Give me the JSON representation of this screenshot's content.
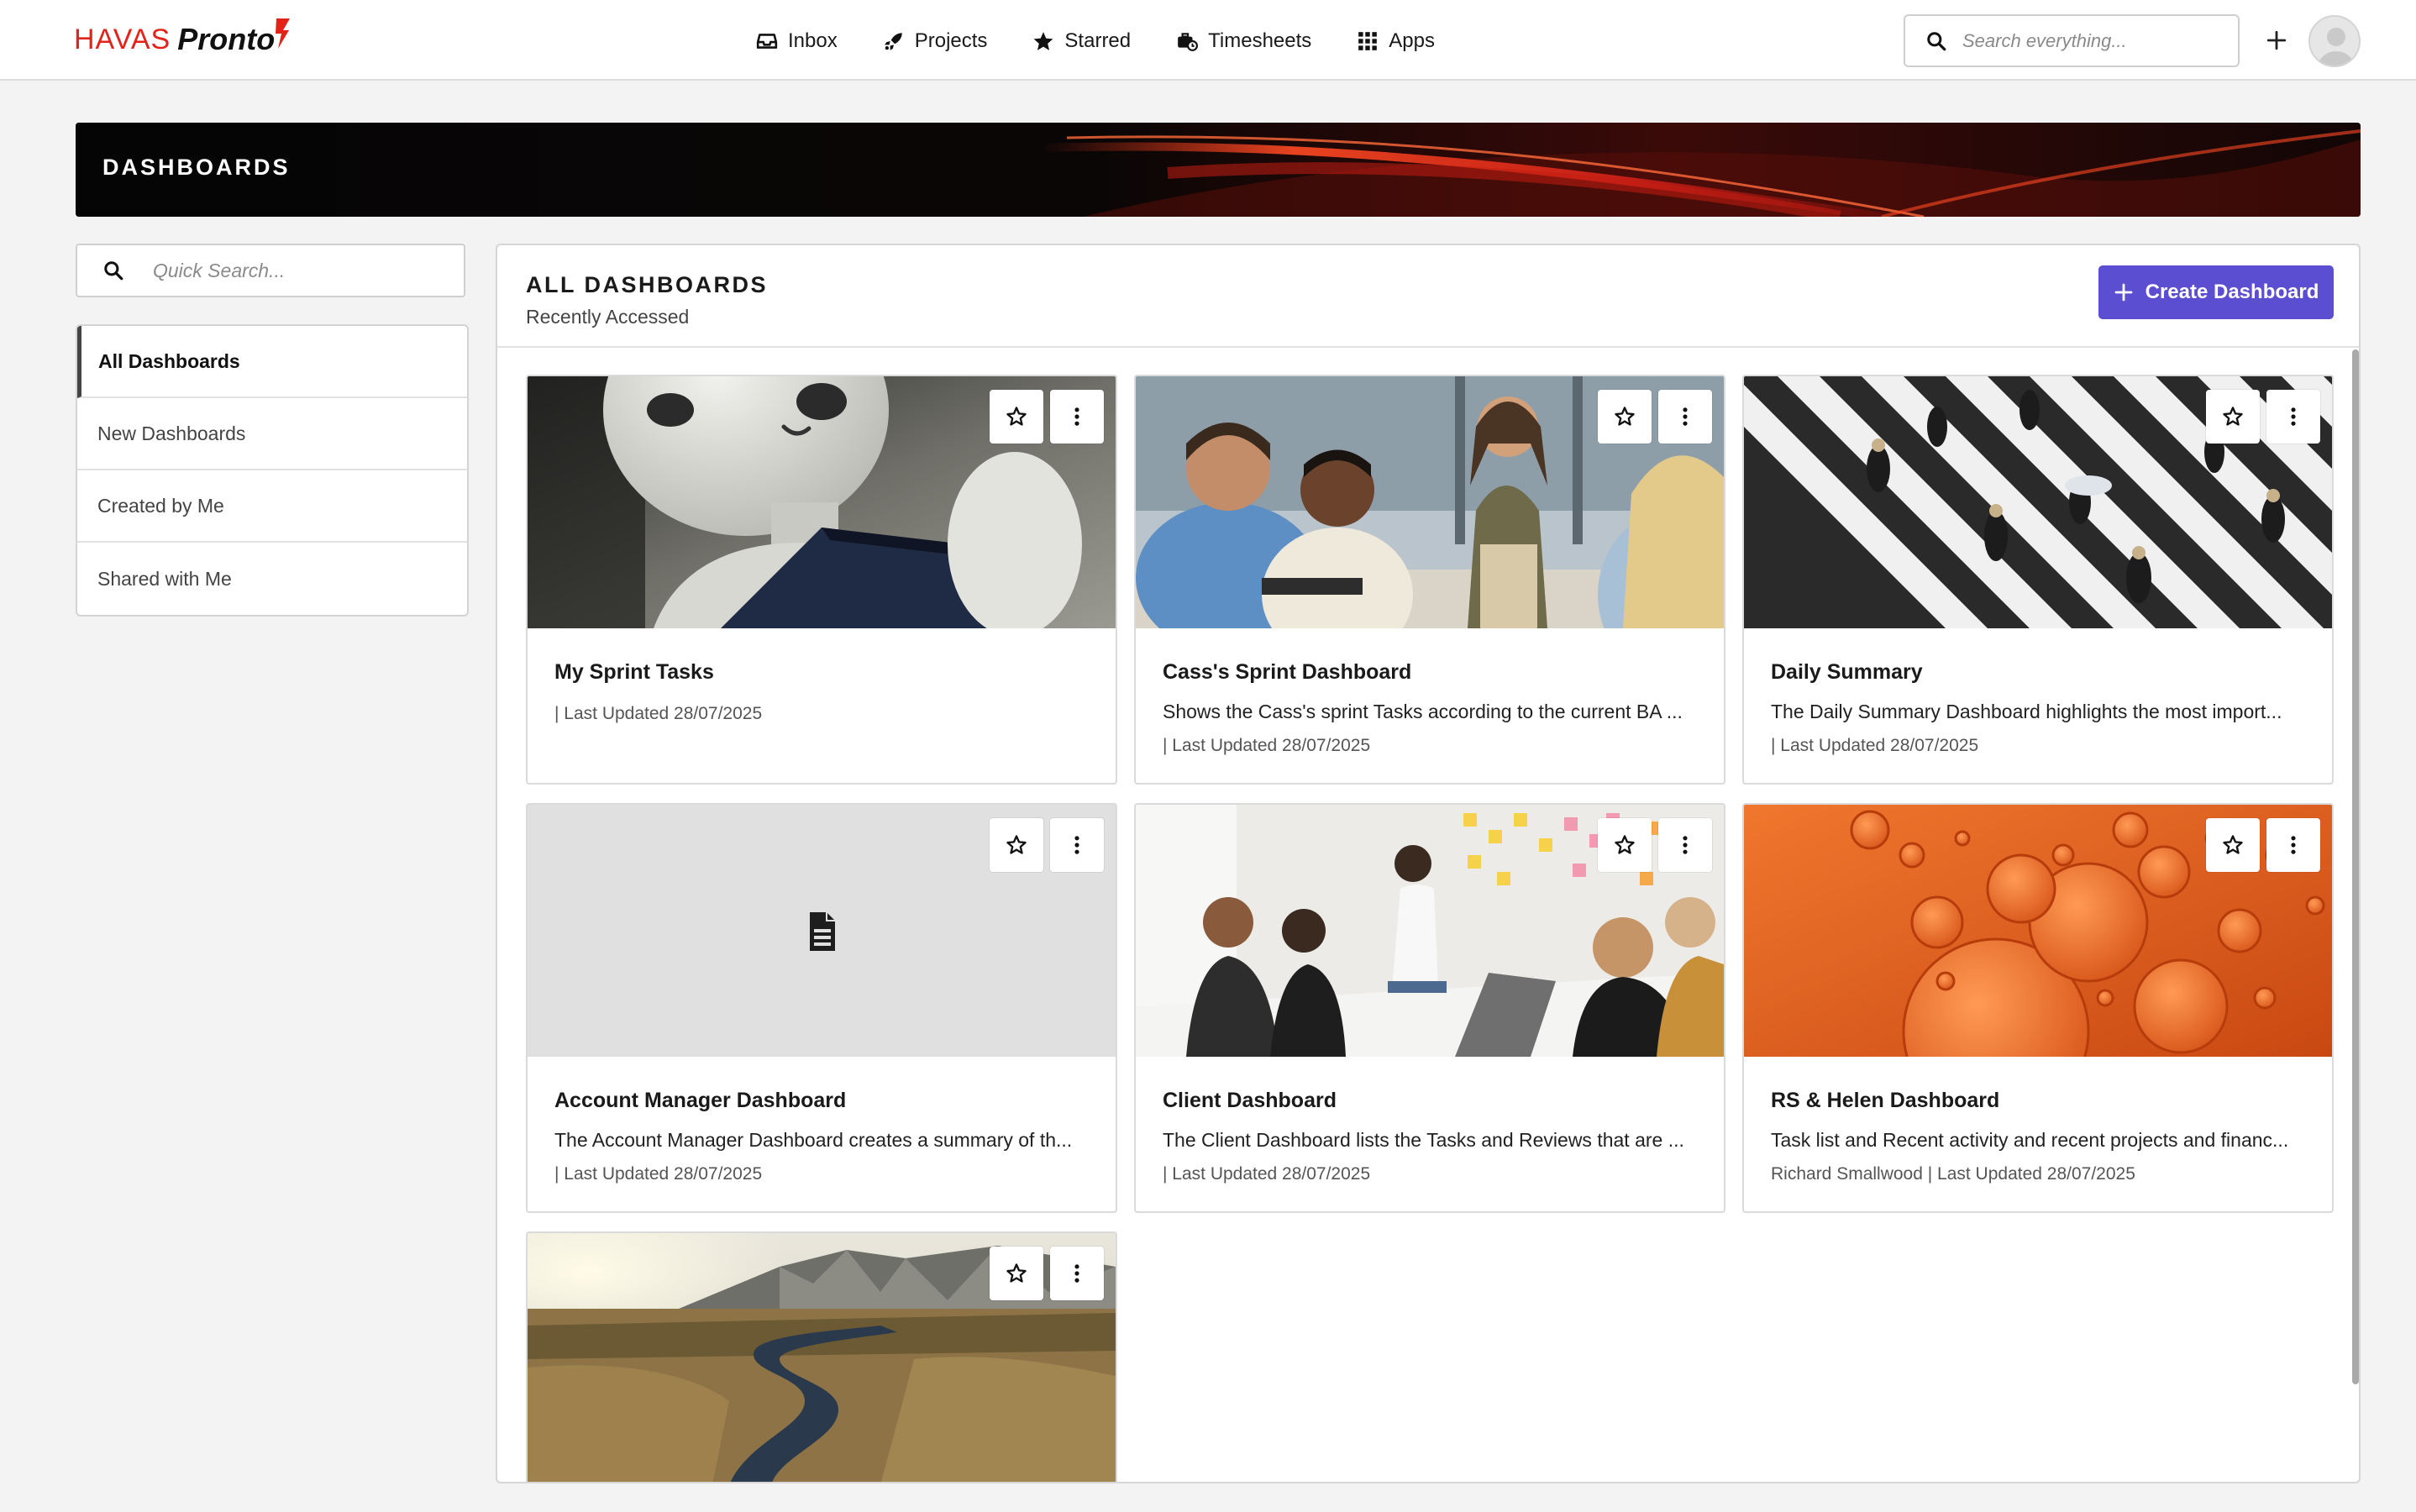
{
  "brand": {
    "name_red": "HAVAS",
    "name_black": "Pronto"
  },
  "nav": {
    "items": [
      {
        "label": "Inbox",
        "icon": "inbox-icon"
      },
      {
        "label": "Projects",
        "icon": "rocket-icon"
      },
      {
        "label": "Starred",
        "icon": "star-icon"
      },
      {
        "label": "Timesheets",
        "icon": "timesheet-icon"
      },
      {
        "label": "Apps",
        "icon": "apps-grid-icon"
      }
    ],
    "search_placeholder": "Search everything..."
  },
  "banner": {
    "title": "DASHBOARDS"
  },
  "sidebar": {
    "search_placeholder": "Quick Search...",
    "items": [
      {
        "label": "All Dashboards",
        "active": true
      },
      {
        "label": "New Dashboards",
        "active": false
      },
      {
        "label": "Created by Me",
        "active": false
      },
      {
        "label": "Shared with Me",
        "active": false
      }
    ]
  },
  "main": {
    "title": "ALL DASHBOARDS",
    "subtitle": "Recently Accessed",
    "create_label": "Create Dashboard",
    "cards": [
      {
        "title": "My Sprint Tasks",
        "description": "",
        "meta": "| Last Updated 28/07/2025",
        "image": "robot-photo"
      },
      {
        "title": "Cass's Sprint Dashboard",
        "description": "Shows the Cass's sprint Tasks according to the current BA ...",
        "meta": "| Last Updated 28/07/2025",
        "image": "meeting-photo"
      },
      {
        "title": "Daily Summary",
        "description": "The Daily Summary Dashboard highlights the most import...",
        "meta": "| Last Updated 28/07/2025",
        "image": "crosswalk-photo"
      },
      {
        "title": "Account Manager Dashboard",
        "description": "The Account Manager Dashboard creates a summary of th...",
        "meta": "| Last Updated 28/07/2025",
        "image": "document-placeholder-icon"
      },
      {
        "title": "Client Dashboard",
        "description": "The Client Dashboard lists the Tasks and Reviews that are ...",
        "meta": "| Last Updated 28/07/2025",
        "image": "office-team-photo"
      },
      {
        "title": "RS & Helen Dashboard",
        "description": "Task list and Recent activity and recent projects and financ...",
        "meta": "Richard Smallwood | Last Updated 28/07/2025",
        "image": "orange-bubbles-photo"
      },
      {
        "title": "",
        "description": "",
        "meta": "",
        "image": "mountain-lake-photo"
      }
    ]
  },
  "colors": {
    "accent": "#5b4ed1",
    "brand_red": "#e2231a"
  }
}
